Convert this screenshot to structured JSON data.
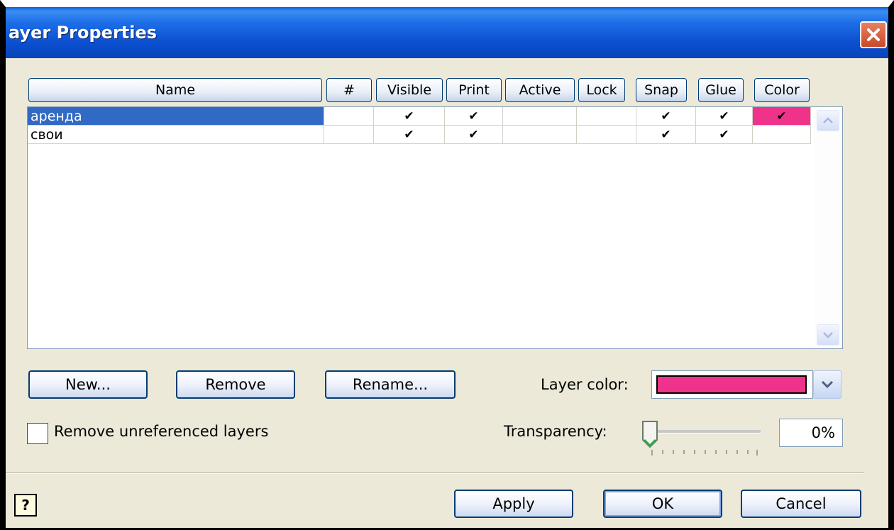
{
  "window": {
    "title": "ayer Properties"
  },
  "columns": [
    "Name",
    "#",
    "Visible",
    "Print",
    "Active",
    "Lock",
    "Snap",
    "Glue",
    "Color"
  ],
  "layers": [
    {
      "name": "аренда",
      "num": "",
      "visible": "✔",
      "print": "✔",
      "active": "",
      "lock": "",
      "snap": "✔",
      "glue": "✔",
      "color": "✔",
      "selected": true
    },
    {
      "name": "свои",
      "num": "",
      "visible": "✔",
      "print": "✔",
      "active": "",
      "lock": "",
      "snap": "✔",
      "glue": "✔",
      "color": "",
      "selected": false
    }
  ],
  "buttons": {
    "new": "New...",
    "remove": "Remove",
    "rename": "Rename...",
    "apply": "Apply",
    "ok": "OK",
    "cancel": "Cancel"
  },
  "layer_color": {
    "label": "Layer color:",
    "value": "#f0338a"
  },
  "remove_unreferenced": {
    "label": "Remove unreferenced layers",
    "checked": false
  },
  "transparency": {
    "label": "Transparency:",
    "value": "0%",
    "level": 0
  },
  "colors": {
    "selection": "#316ac5",
    "layer_pink": "#f0338a"
  },
  "icons": {
    "close": "close-icon",
    "help": "help-icon",
    "dropdown": "chevron-down-icon"
  }
}
